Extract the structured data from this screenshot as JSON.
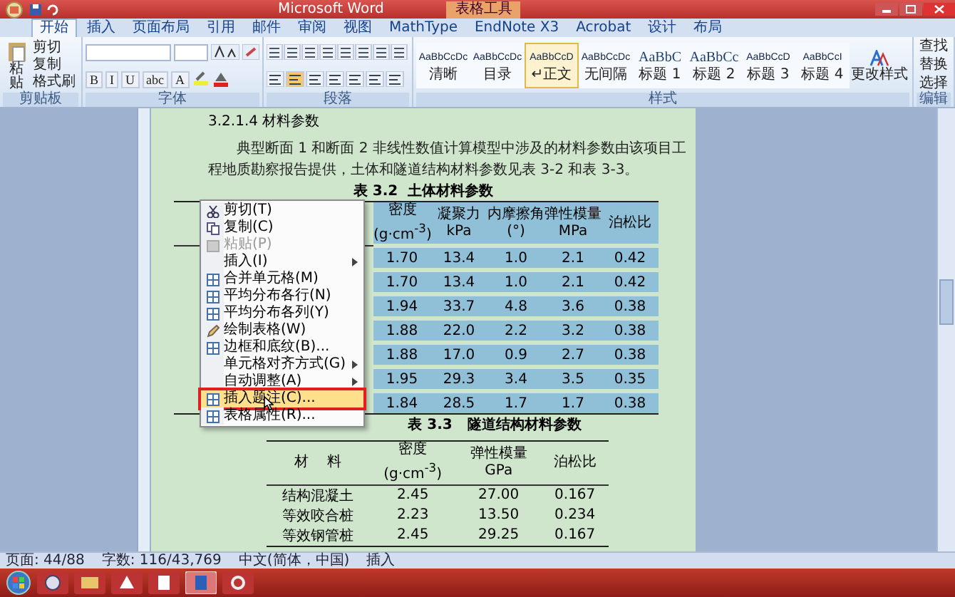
{
  "window": {
    "title": "Microsoft Word",
    "context_tab": "表格工具"
  },
  "tabs": [
    {
      "label": "开始",
      "selected": true
    },
    {
      "label": "插入",
      "selected": false
    },
    {
      "label": "页面布局",
      "selected": false
    },
    {
      "label": "引用",
      "selected": false
    },
    {
      "label": "邮件",
      "selected": false
    },
    {
      "label": "审阅",
      "selected": false
    },
    {
      "label": "视图",
      "selected": false
    },
    {
      "label": "MathType",
      "selected": false
    },
    {
      "label": "EndNote X3",
      "selected": false
    },
    {
      "label": "Acrobat",
      "selected": false
    },
    {
      "label": "设计",
      "selected": false
    },
    {
      "label": "布局",
      "selected": false
    }
  ],
  "ribbon": {
    "clipboard": {
      "label": "剪贴板",
      "paste": "粘贴",
      "items": [
        "剪切",
        "复制",
        "格式刷"
      ]
    },
    "font": {
      "label": "字体",
      "format_buttons": [
        "B",
        "I",
        "U",
        "abc",
        "A"
      ]
    },
    "paragraph": {
      "label": "段落"
    },
    "styles": {
      "label": "样式",
      "change": "更改样式",
      "items": [
        {
          "sample": "AaBbCcDc",
          "label": "清晰",
          "selected": false
        },
        {
          "sample": "AaBbCcDc",
          "label": "目录",
          "selected": false
        },
        {
          "sample": "AaBbCcD",
          "label": "↵正文",
          "selected": true
        },
        {
          "sample": "AaBbCcDc",
          "label": "无间隔",
          "selected": false
        },
        {
          "sample": "AaBbC",
          "label": "标题 1",
          "selected": false
        },
        {
          "sample": "AaBbCc",
          "label": "标题 2",
          "selected": false
        },
        {
          "sample": "AaBbCcD",
          "label": "标题 3",
          "selected": false
        },
        {
          "sample": "AaBbCcI",
          "label": "标题 4",
          "selected": false
        }
      ]
    },
    "editing": {
      "label": "编辑",
      "items": [
        "查找",
        "替换",
        "选择"
      ]
    }
  },
  "document": {
    "heading": "3.2.1.4 材料参数",
    "paragraph": "典型断面 1 和断面 2 非线性数值计算模型中涉及的材料参数由该项目工程地质勘察报告提供，土体和隧道结构材料参数见表 3-2 和表 3-3。",
    "table_1": {
      "caption": "表 3.2  土体材料参数",
      "selected": true,
      "columns": [
        "密度\n(g·cm$^{-3}$)",
        "凝聚力\nkPa",
        "内摩擦角\n(°)",
        "弹性模量\nMPa",
        "泊松比"
      ],
      "rows": [
        [
          "1.70",
          "13.4",
          "1.0",
          "2.1",
          "0.42"
        ],
        [
          "1.70",
          "13.4",
          "1.0",
          "2.1",
          "0.42"
        ],
        [
          "1.94",
          "33.7",
          "4.8",
          "3.6",
          "0.38"
        ],
        [
          "1.88",
          "22.0",
          "2.2",
          "3.2",
          "0.38"
        ],
        [
          "1.88",
          "17.0",
          "0.9",
          "2.7",
          "0.38"
        ],
        [
          "1.95",
          "29.3",
          "3.4",
          "3.5",
          "0.35"
        ],
        [
          "1.84",
          "28.5",
          "1.7",
          "1.7",
          "0.38"
        ]
      ]
    },
    "table_2": {
      "caption": "表 3.3   隧道结构材料参数",
      "columns": [
        "材    料",
        "密度\n(g·cm$^{-3}$)",
        "弹性模量\nGPa",
        "泊松比"
      ],
      "rows": [
        [
          "结构混凝土",
          "2.45",
          "27.00",
          "0.167"
        ],
        [
          "等效咬合桩",
          "2.23",
          "13.50",
          "0.234"
        ],
        [
          "等效钢管桩",
          "2.45",
          "29.25",
          "0.167"
        ]
      ]
    }
  },
  "context_menu": [
    {
      "label": "剪切(T)",
      "disabled": false,
      "submenu": false,
      "selected": false
    },
    {
      "label": "复制(C)",
      "disabled": false,
      "submenu": false,
      "selected": false
    },
    {
      "label": "粘贴(P)",
      "disabled": true,
      "submenu": false,
      "selected": false
    },
    {
      "label": "插入(I)",
      "disabled": false,
      "submenu": true,
      "selected": false
    },
    {
      "label": "合并单元格(M)",
      "disabled": false,
      "submenu": false,
      "selected": false
    },
    {
      "label": "平均分布各行(N)",
      "disabled": false,
      "submenu": false,
      "selected": false
    },
    {
      "label": "平均分布各列(Y)",
      "disabled": false,
      "submenu": false,
      "selected": false
    },
    {
      "label": "绘制表格(W)",
      "disabled": false,
      "submenu": false,
      "selected": false
    },
    {
      "label": "边框和底纹(B)...",
      "disabled": false,
      "submenu": false,
      "selected": false
    },
    {
      "label": "单元格对齐方式(G)",
      "disabled": false,
      "submenu": true,
      "selected": false
    },
    {
      "label": "自动调整(A)",
      "disabled": false,
      "submenu": true,
      "selected": false
    },
    {
      "label": "插入题注(C)...",
      "disabled": false,
      "submenu": false,
      "selected": true
    },
    {
      "label": "表格属性(R)...",
      "disabled": false,
      "submenu": false,
      "selected": false
    }
  ],
  "status_bar": [
    "页面: 44/88",
    "字数: 116/43,769",
    "中文(简体，中国)",
    "插入"
  ]
}
